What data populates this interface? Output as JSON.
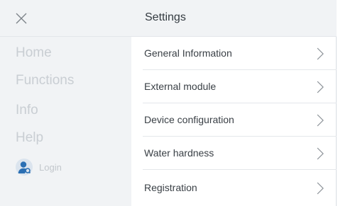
{
  "header": {
    "title": "Settings",
    "close_icon": "close-icon"
  },
  "sidebar": {
    "items": [
      {
        "label": "Home"
      },
      {
        "label": "Functions"
      },
      {
        "label": "Info"
      },
      {
        "label": "Help"
      }
    ],
    "login": {
      "label": "Login",
      "icon": "user-search-icon"
    }
  },
  "settings_list": {
    "items": [
      {
        "label": "General Information",
        "icon": "chevron-right-icon"
      },
      {
        "label": "External module",
        "icon": "chevron-right-icon"
      },
      {
        "label": "Device configuration",
        "icon": "chevron-right-icon"
      },
      {
        "label": "Water hardness",
        "icon": "chevron-right-icon"
      },
      {
        "label": "Registration",
        "icon": "chevron-right-icon"
      }
    ]
  },
  "colors": {
    "panel_bg": "#f1f3f5",
    "text_primary": "#3a4046",
    "text_muted": "#c9ced3",
    "accent_blue": "#2b6fb3"
  }
}
